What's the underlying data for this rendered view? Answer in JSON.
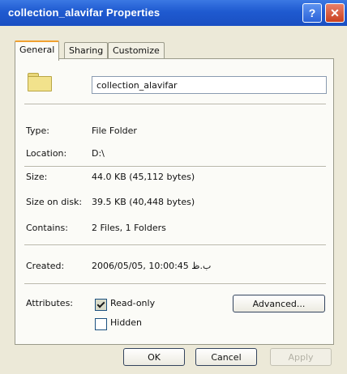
{
  "window": {
    "title": "collection_alavifar Properties",
    "help_label": "?",
    "close_label": "✕"
  },
  "tabs": [
    {
      "label": "General"
    },
    {
      "label": "Sharing"
    },
    {
      "label": "Customize"
    }
  ],
  "general": {
    "name_value": "collection_alavifar",
    "folder_icon": "folder-icon",
    "props": [
      {
        "label": "Type:",
        "value": "File Folder"
      },
      {
        "label": "Location:",
        "value": "D:\\"
      },
      {
        "label": "Size:",
        "value": "44.0 KB (45,112 bytes)"
      },
      {
        "label": "Size on disk:",
        "value": "39.5 KB (40,448 bytes)"
      },
      {
        "label": "Contains:",
        "value": "2 Files, 1 Folders"
      }
    ],
    "created_label": "Created:",
    "created_value": "2006/05/05, 10:00:45 ب.ظ",
    "attributes_label": "Attributes:",
    "readonly_label": "Read-only",
    "hidden_label": "Hidden",
    "advanced_label": "Advanced..."
  },
  "buttons": {
    "ok": "OK",
    "cancel": "Cancel",
    "apply": "Apply"
  }
}
